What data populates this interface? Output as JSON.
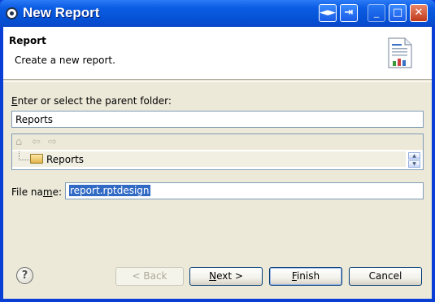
{
  "window": {
    "title": "New Report"
  },
  "title_buttons": [
    "◄►",
    "⇥",
    "_",
    "□",
    "✕"
  ],
  "header": {
    "title": "Report",
    "description": "Create a new report."
  },
  "folder": {
    "label_prefix": "E",
    "label_rest": "nter or select the parent folder:",
    "value": "Reports"
  },
  "tree": {
    "items": [
      {
        "label": "Reports"
      }
    ]
  },
  "file": {
    "label_prefix": "File na",
    "label_mnemonic": "m",
    "label_suffix": "e:",
    "value": "report.rptdesign"
  },
  "buttons": {
    "back": "< Back",
    "next_mnemonic": "N",
    "next_rest": "ext >",
    "finish_mnemonic": "F",
    "finish_rest": "inish",
    "cancel": "Cancel"
  },
  "icons": {
    "help": "?",
    "home": "⌂",
    "back_arrow": "⇦",
    "forward_arrow": "⇨"
  }
}
